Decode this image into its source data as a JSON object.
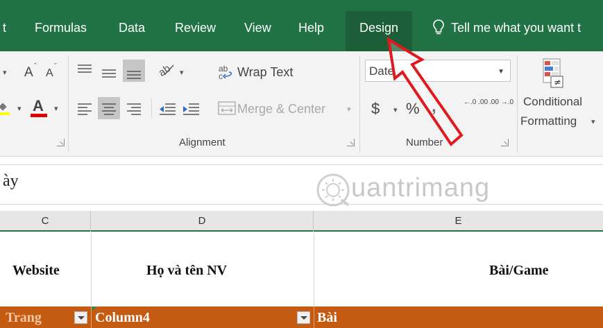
{
  "tabs": [
    {
      "label": "t"
    },
    {
      "label": "Formulas"
    },
    {
      "label": "Data"
    },
    {
      "label": "Review"
    },
    {
      "label": "View"
    },
    {
      "label": "Help"
    },
    {
      "label": "Design",
      "active": true
    }
  ],
  "tell_me": "Tell me what you want t",
  "ribbon": {
    "font": {
      "grow_label": "A",
      "shrink_label": "A",
      "font_color_label": "A"
    },
    "alignment": {
      "wrap_text": "Wrap Text",
      "merge_center": "Merge & Center",
      "group_label": "Alignment"
    },
    "number": {
      "format_value": "Date",
      "currency_symbol": "$",
      "percent_symbol": "%",
      "comma_symbol": ",",
      "increase_decimal": "←.0 .00",
      "decrease_decimal": ".00 →.0",
      "group_label": "Number"
    },
    "styles": {
      "conditional_formatting_line1": "Conditional",
      "conditional_formatting_line2": "Formatting"
    }
  },
  "formula_bar": {
    "value": "ày"
  },
  "watermark": "uantrimang",
  "columns": [
    {
      "letter": "C"
    },
    {
      "letter": "D"
    },
    {
      "letter": "E"
    }
  ],
  "cells": {
    "c": "Website",
    "d": "Họ và tên NV",
    "e": "Bài/Game"
  },
  "table_header": {
    "c": "Trang",
    "d": "Column4",
    "e": "Bài"
  },
  "colors": {
    "ribbon_green": "#217346",
    "active_tab": "#1b5e38",
    "table_header": "#c55a11",
    "arrow_red": "#e0191e"
  }
}
